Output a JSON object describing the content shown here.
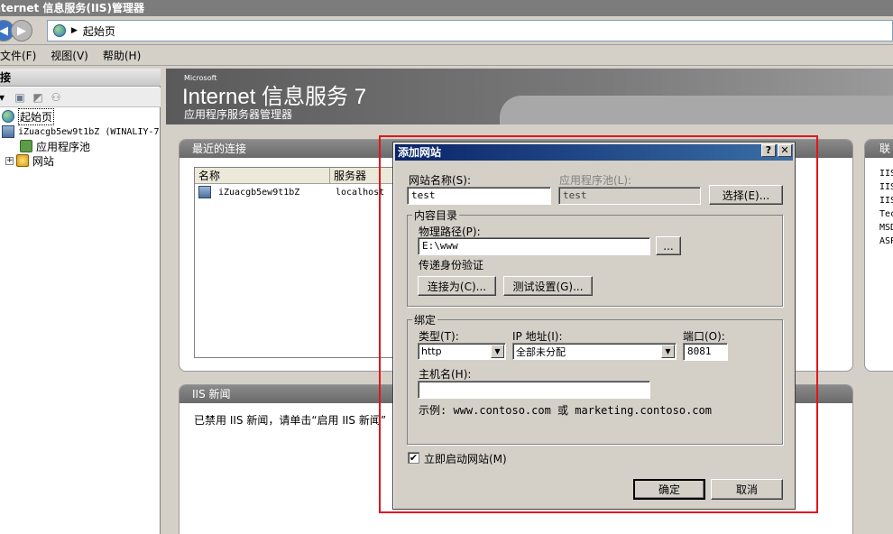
{
  "window": {
    "title": "Internet 信息服务(IIS)管理器"
  },
  "address": {
    "path": "起始页"
  },
  "menu": {
    "file": "文件(F)",
    "view": "视图(V)",
    "help": "帮助(H)"
  },
  "connections": {
    "header": "连接",
    "tree": [
      {
        "label": "起始页",
        "icon": "start-page-icon"
      },
      {
        "label": "iZuacgb5ew9t1bZ (WINALIY-7",
        "icon": "server-icon"
      },
      {
        "label": "应用程序池",
        "icon": "app-pool-icon"
      },
      {
        "label": "网站",
        "icon": "sites-icon"
      }
    ]
  },
  "banner": {
    "brand": "Microsoft",
    "title": "Internet 信息服务 7",
    "subtitle": "应用程序服务器管理器"
  },
  "recent": {
    "header": "最近的连接",
    "columns": [
      "名称",
      "服务器"
    ],
    "rows": [
      {
        "name": "iZuacgb5ew9t1bZ",
        "server": "localhost"
      }
    ]
  },
  "links": {
    "header": "联",
    "items": [
      "IIS",
      "IIS",
      "IIS",
      "Tec",
      "MSD",
      "ASP"
    ]
  },
  "news": {
    "header": "IIS 新闻",
    "text": "已禁用 IIS 新闻，请单击“启用 IIS 新闻”"
  },
  "dialog": {
    "title": "添加网站",
    "help_btn": "?",
    "close_btn": "✕",
    "site_name_label": "网站名称(S):",
    "site_name": "test",
    "app_pool_label": "应用程序池(L):",
    "app_pool": "test",
    "select_btn": "选择(E)...",
    "content_group": "内容目录",
    "physical_path_label": "物理路径(P):",
    "physical_path": "E:\\www",
    "browse_btn": "...",
    "pass_auth_label": "传递身份验证",
    "connect_as_btn": "连接为(C)...",
    "test_settings_btn": "测试设置(G)...",
    "binding_group": "绑定",
    "type_label": "类型(T):",
    "type_value": "http",
    "ip_label": "IP 地址(I):",
    "ip_value": "全部未分配",
    "port_label": "端口(O):",
    "port_value": "8081",
    "host_label": "主机名(H):",
    "host_value": "",
    "example": "示例: www.contoso.com 或 marketing.contoso.com",
    "start_now_label": "立即启动网站(M)",
    "start_now_checked": "✔",
    "ok_btn": "确定",
    "cancel_btn": "取消"
  },
  "colors": {
    "highlight": "#e0151d",
    "title_bar": "#0a246a"
  }
}
